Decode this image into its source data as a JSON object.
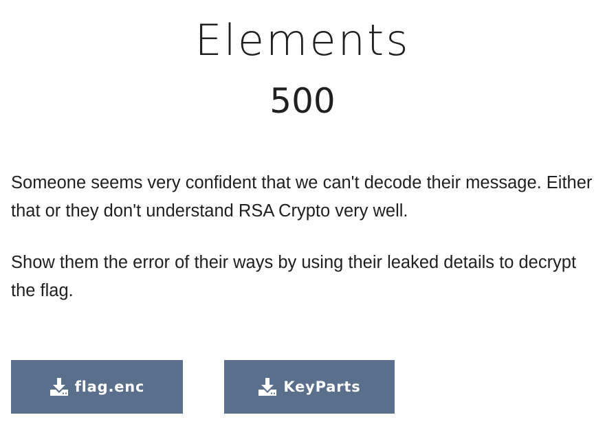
{
  "challenge": {
    "title": "Elements",
    "points": "500",
    "description": [
      "Someone seems very confident that we can't decode their message. Either that or they don't understand RSA Crypto very well.",
      "Show them the error of their ways by using their leaked details to decrypt the flag."
    ]
  },
  "downloads": [
    {
      "label": "flag.enc",
      "icon": "download-icon"
    },
    {
      "label": "KeyParts",
      "icon": "download-icon"
    }
  ],
  "colors": {
    "button_background": "#5a6f8b",
    "button_text": "#ffffff",
    "text": "#1f1f1f"
  }
}
